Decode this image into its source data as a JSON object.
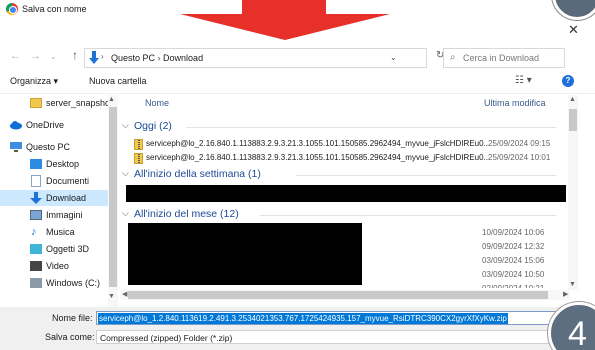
{
  "window": {
    "title": "Salva con nome"
  },
  "overlay": {
    "step_number": "4"
  },
  "nav": {
    "breadcrumb": [
      "Questo PC",
      "Download"
    ],
    "search_placeholder": "Cerca in Download"
  },
  "toolbar": {
    "organize_label": "Organizza ▾",
    "new_folder_label": "Nuova cartella"
  },
  "sidebar": {
    "items": [
      {
        "label": "server_snapshot",
        "icon": "folder-icon"
      },
      {
        "label": "OneDrive",
        "icon": "cloud-icon"
      },
      {
        "label": "Questo PC",
        "icon": "computer-icon"
      },
      {
        "label": "Desktop",
        "icon": "desktop-icon"
      },
      {
        "label": "Documenti",
        "icon": "document-icon"
      },
      {
        "label": "Download",
        "icon": "download-icon"
      },
      {
        "label": "Immagini",
        "icon": "image-icon"
      },
      {
        "label": "Musica",
        "icon": "music-icon"
      },
      {
        "label": "Oggetti 3D",
        "icon": "cube-icon"
      },
      {
        "label": "Video",
        "icon": "video-icon"
      },
      {
        "label": "Windows (C:)",
        "icon": "drive-icon"
      }
    ]
  },
  "list": {
    "col_name": "Nome",
    "col_modified": "Ultima modifica",
    "groups": [
      {
        "label": "Oggi (2)"
      },
      {
        "label": "All'inizio della settimana (1)"
      },
      {
        "label": "All'inizio del mese (12)"
      }
    ],
    "files": [
      {
        "name": "serviceph@lo_2.16.840.1.113883.2.9.3.21.3.1055.101.150585.2962494_myvue_jFslcHDIREu0...",
        "modified": "25/09/2024 09:15"
      },
      {
        "name": "serviceph@lo_2.16.840.1.113883.2.9.3.21.3.1055.101.150585.2962494_myvue_jFslcHDIREu0...",
        "modified": "25/09/2024 10:01"
      }
    ],
    "month_dates": [
      "10/09/2024 10:06",
      "09/09/2024 12:32",
      "03/09/2024 15:06",
      "03/09/2024 10:50",
      "02/09/2024 10:21"
    ]
  },
  "form": {
    "filename_label": "Nome file:",
    "filename_value": "serviceph@lo_1.2.840.113619.2.491.3.2534021353.767.1725424935.157_myvue_RsiDTRC390CX2gyrXfXyKw.zip",
    "type_label": "Salva come:",
    "type_value": "Compressed (zipped) Folder (*.zip)"
  }
}
